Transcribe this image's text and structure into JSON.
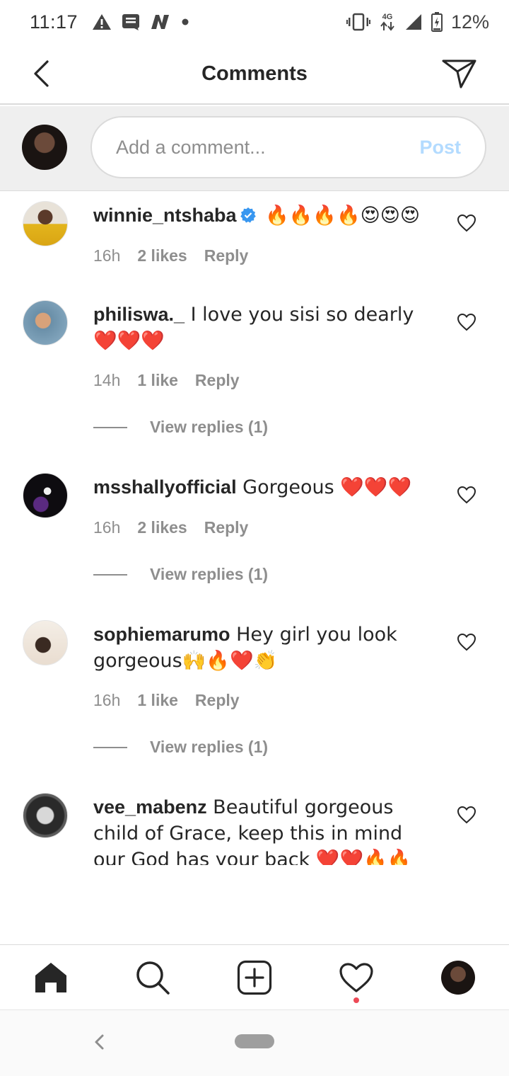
{
  "status_bar": {
    "time": "11:17",
    "network": "4G",
    "battery": "12%",
    "icons": [
      "warning-icon",
      "message-icon",
      "n-app-icon",
      "dot-icon",
      "vibrate-icon",
      "data-icon",
      "signal-icon",
      "battery-icon"
    ]
  },
  "header": {
    "title": "Comments",
    "back_icon": "chevron-left-icon",
    "share_icon": "paper-plane-icon"
  },
  "compose": {
    "placeholder": "Add a comment...",
    "post_label": "Post",
    "post_color": "#b3dbff"
  },
  "comments": [
    {
      "username": "winnie_ntshaba",
      "verified": true,
      "text": " 🔥🔥🔥🔥😍😍😍",
      "time": "16h",
      "likes": "2 likes",
      "reply": "Reply"
    },
    {
      "username": "philiswa._",
      "text": " I love you sisi so dearly❤️❤️❤️",
      "time": "14h",
      "likes": "1 like",
      "reply": "Reply",
      "view_replies": "View replies (1)"
    },
    {
      "username": "msshallyofficial",
      "text": " Gorgeous ❤️❤️❤️",
      "time": "16h",
      "likes": "2 likes",
      "reply": "Reply",
      "view_replies": "View replies (1)"
    },
    {
      "username": "sophiemarumo",
      "text": " Hey girl you look gorgeous🙌🔥❤️👏",
      "time": "16h",
      "likes": "1 like",
      "reply": "Reply",
      "view_replies": "View replies (1)"
    },
    {
      "username": "vee_mabenz",
      "text": " Beautiful gorgeous child of Grace, keep this in mind our God has your back ❤️❤️🔥🔥🔥🔥😍😍"
    }
  ],
  "colors": {
    "accent_blue": "#3897f0",
    "muted_text": "#8e8e8e",
    "notification_dot": "#ed4956"
  },
  "bottom_nav": [
    "home-icon",
    "search-icon",
    "add-post-icon",
    "activity-heart-icon",
    "profile-avatar"
  ]
}
